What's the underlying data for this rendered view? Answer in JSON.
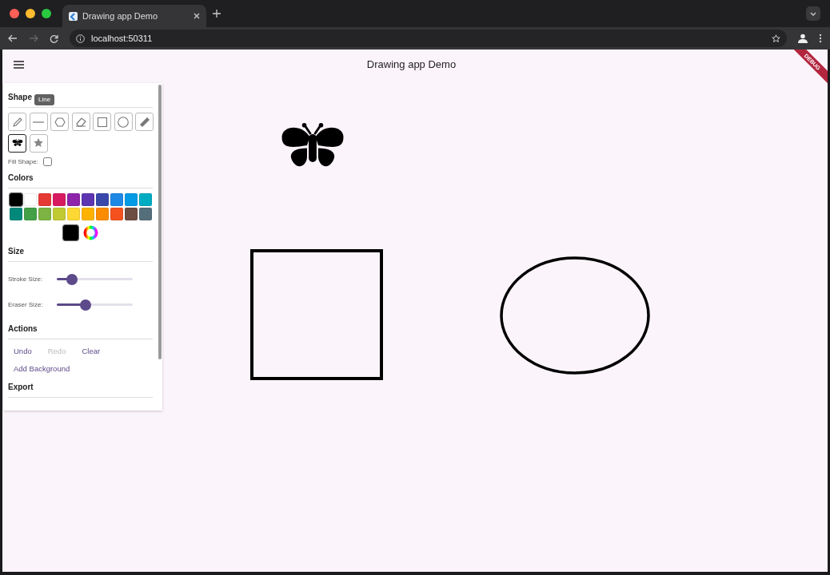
{
  "browser": {
    "tab_title": "Drawing app Demo",
    "url": "localhost:50311"
  },
  "app_bar": {
    "title": "Drawing app Demo",
    "debug_banner": "DEBUG"
  },
  "panel": {
    "shapes": {
      "heading": "Shape",
      "tooltip": "Line",
      "tools": [
        {
          "kind": "pencil",
          "selected": false
        },
        {
          "kind": "line",
          "selected": false
        },
        {
          "kind": "polygon",
          "selected": false
        },
        {
          "kind": "eraser",
          "selected": false
        },
        {
          "kind": "square",
          "selected": false
        },
        {
          "kind": "circle",
          "selected": false
        },
        {
          "kind": "ruler",
          "selected": false
        },
        {
          "kind": "butterfly",
          "selected": true
        },
        {
          "kind": "star",
          "selected": false
        }
      ],
      "fill_shape": {
        "label": "Fill Shape:",
        "checked": false
      }
    },
    "colors": {
      "heading": "Colors",
      "swatches": [
        {
          "color": "#000000",
          "selected": true
        },
        {
          "color": "#ffffff",
          "selected": false
        },
        {
          "color": "#e53935",
          "selected": false
        },
        {
          "color": "#d81b60",
          "selected": false
        },
        {
          "color": "#8e24aa",
          "selected": false
        },
        {
          "color": "#5e35b1",
          "selected": false
        },
        {
          "color": "#3949ab",
          "selected": false
        },
        {
          "color": "#1e88e5",
          "selected": false
        },
        {
          "color": "#039be5",
          "selected": false
        },
        {
          "color": "#00acc1",
          "selected": false
        },
        {
          "color": "#00897b",
          "selected": false
        },
        {
          "color": "#43a047",
          "selected": false
        },
        {
          "color": "#7cb342",
          "selected": false
        },
        {
          "color": "#c0ca33",
          "selected": false
        },
        {
          "color": "#fdd835",
          "selected": false
        },
        {
          "color": "#ffb300",
          "selected": false
        },
        {
          "color": "#fb8c00",
          "selected": false
        },
        {
          "color": "#f4511e",
          "selected": false
        },
        {
          "color": "#6d4c41",
          "selected": false
        },
        {
          "color": "#546e7a",
          "selected": false
        }
      ],
      "current_swatch": {
        "color": "#000000"
      }
    },
    "size": {
      "heading": "Size",
      "sliders": [
        {
          "label": "Stroke Size:",
          "level": 0.2
        },
        {
          "label": "Eraser Size:",
          "level": 0.38
        }
      ]
    },
    "actions": {
      "heading": "Actions",
      "buttons": [
        {
          "label": "Undo",
          "disabled": false
        },
        {
          "label": "Redo",
          "disabled": true
        },
        {
          "label": "Clear",
          "disabled": false
        },
        {
          "label": "Add Background",
          "disabled": false
        }
      ]
    },
    "export": {
      "heading": "Export"
    }
  },
  "canvas": {
    "shapes": [
      {
        "kind": "butterfly"
      },
      {
        "kind": "rectangle"
      },
      {
        "kind": "ellipse"
      }
    ]
  }
}
